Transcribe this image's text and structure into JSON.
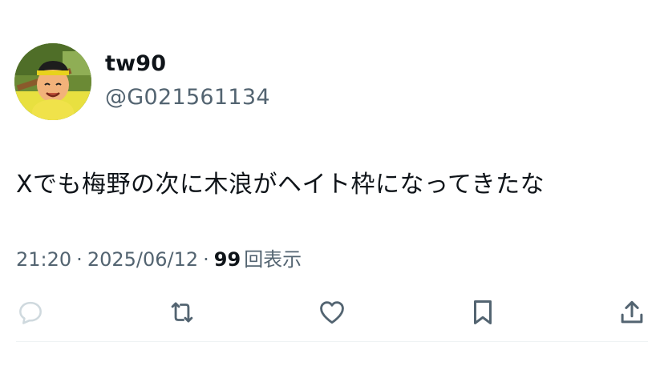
{
  "tweet": {
    "display_name": "tw90",
    "handle": "@G021561134",
    "text": "Xでも梅野の次に木浪がヘイト枠になってきたな",
    "time": "21:20",
    "separator": "·",
    "date": "2025/06/12",
    "views_count": "99",
    "views_label": "回表示"
  },
  "actions": [
    {
      "name": "reply",
      "icon": "speech-bubble-icon"
    },
    {
      "name": "retweet",
      "icon": "retweet-icon"
    },
    {
      "name": "like",
      "icon": "heart-icon"
    },
    {
      "name": "bookmark",
      "icon": "bookmark-icon"
    },
    {
      "name": "share",
      "icon": "share-upload-icon"
    }
  ],
  "colors": {
    "text_primary": "#0f1419",
    "text_secondary": "#536471",
    "divider": "#eff3f4"
  }
}
